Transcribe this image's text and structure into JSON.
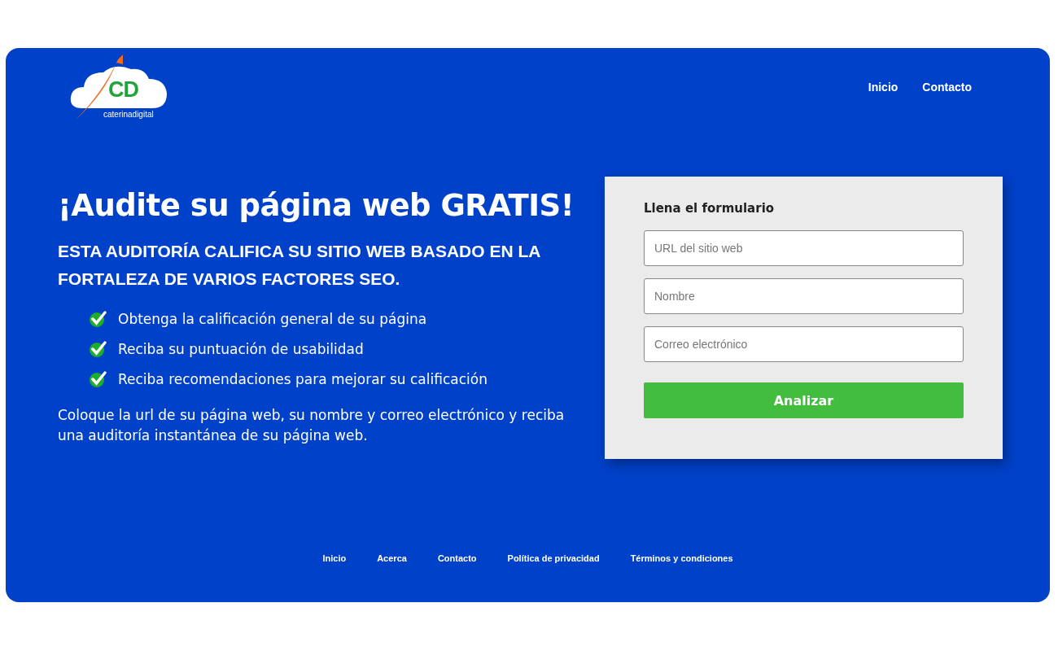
{
  "logo": {
    "letters": "CD",
    "wordmark": "caterinadigital"
  },
  "nav": [
    "Inicio",
    "Contacto"
  ],
  "hero": {
    "title": "¡Audite su página web GRATIS!",
    "subtitle": "ESTA AUDITORÍA CALIFICA SU SITIO WEB BASADO EN LA FORTALEZA DE VARIOS FACTORES SEO.",
    "benefits": [
      "Obtenga la calificación general de su página",
      "Reciba su puntuación de usabilidad",
      "Reciba recomendaciones para mejorar su calificación"
    ],
    "description": "Coloque la url de su página web, su nombre y correo electrónico y reciba una auditoría instantánea de su página web."
  },
  "form": {
    "title": "Llena el formulario",
    "fields": [
      {
        "placeholder": "URL del sitio web"
      },
      {
        "placeholder": "Nombre"
      },
      {
        "placeholder": "Correo electrónico"
      }
    ],
    "button": "Analizar"
  },
  "footer": [
    "Inicio",
    "Acerca",
    "Contacto",
    "Política de privacidad",
    "Términos y condiciones"
  ]
}
